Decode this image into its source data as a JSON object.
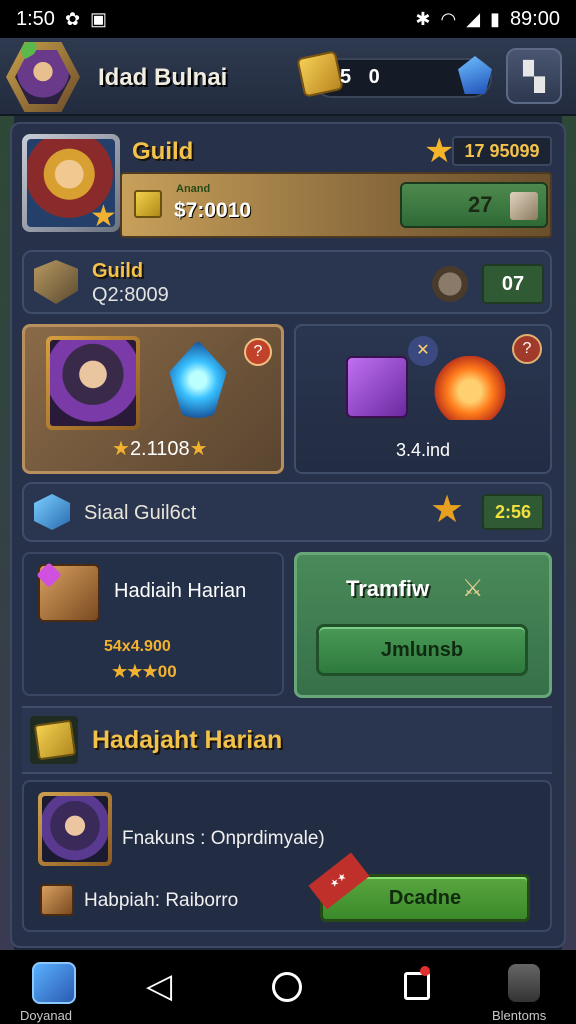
{
  "status_bar": {
    "time": "1:50",
    "right_text": "89:00",
    "icons": [
      "notification-icon",
      "news-icon",
      "bluetooth-icon",
      "wifi-icon",
      "signal-icon",
      "battery-icon"
    ]
  },
  "header": {
    "player_name": "Idad Bulnai",
    "currency_value": "5 0",
    "menu_icon": "grid-menu-icon"
  },
  "guild_card": {
    "title": "Guild",
    "rank_value": "17 95099",
    "small_label": "Anand",
    "money": "$7:0010",
    "button_value": "27"
  },
  "guild_row": {
    "title": "Guild",
    "subtitle": "Q2:8009",
    "value": "07"
  },
  "events": [
    {
      "value": "2.1108",
      "badge": "?"
    },
    {
      "value": "3.4.ind",
      "badge": "?"
    }
  ],
  "special_guild": {
    "label": "Siaal Guil6ct",
    "value": "2:56"
  },
  "daily_cards": {
    "left": {
      "title": "Hadiaih Harian",
      "value": "54x4.900",
      "stars_value": "00"
    },
    "right": {
      "title": "Tramfiw",
      "button_label": "Jmlunsb"
    }
  },
  "daily_header": {
    "title": "Hadajaht Harian"
  },
  "bottom_card": {
    "line1": "Fnakuns : Onprdimyale)",
    "line2": "Habpiah: Raiborro",
    "button_label": "Dcadne"
  },
  "nav_bar": {
    "left_label": "Doyanad",
    "right_label": "Blentoms"
  },
  "colors": {
    "background": "#1e2838",
    "panel": "#27324a",
    "gold": "#f3c24a",
    "green_button": "#3a8a2a"
  }
}
